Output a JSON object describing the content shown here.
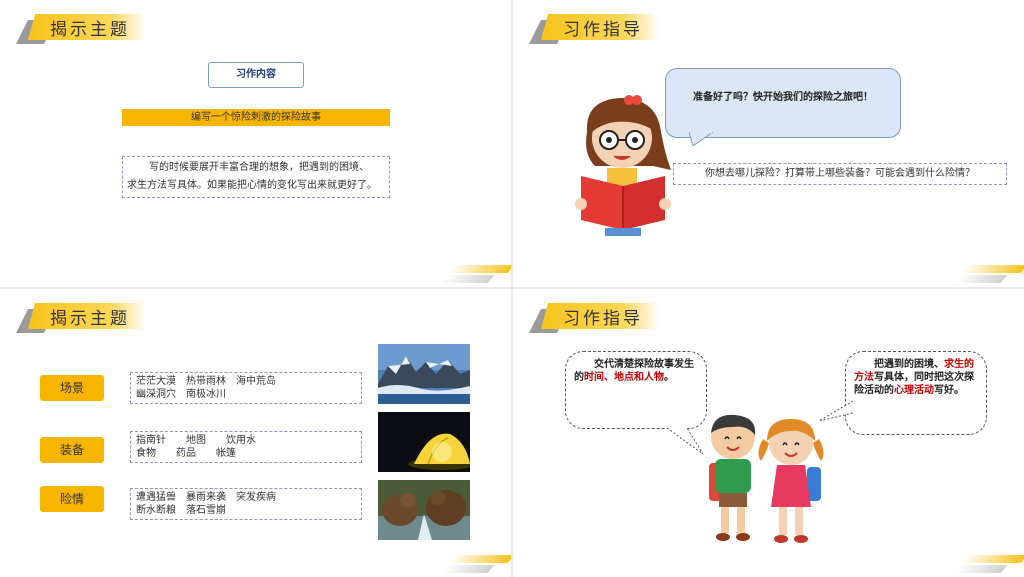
{
  "slide1": {
    "title": "揭示主题",
    "content_label": "习作内容",
    "topic": "编写一个惊险刺激的探险故事",
    "tip_line1": "写的时候要展开丰富合理的想象，把遇到的困境、",
    "tip_line2": "求生方法写具体。如果能把心情的变化写出来就更好了。"
  },
  "slide2": {
    "title": "习作指导",
    "bubble": "准备好了吗？快开始我们的探险之旅吧！",
    "question": "你想去哪儿探险？打算带上哪些装备？可能会遇到什么险情？"
  },
  "slide3": {
    "title": "揭示主题",
    "rows": [
      {
        "label": "场景",
        "line1": "茫茫大漠　热带雨林　海中荒岛",
        "line2": "幽深洞穴　南极冰川",
        "image": "iceberg-photo"
      },
      {
        "label": "装备",
        "line1": "指南针　　地图　　饮用水",
        "line2": "食物　　药品　　帐篷",
        "image": "tent-photo"
      },
      {
        "label": "险情",
        "line1": "遭遇猛兽　暴雨来袭　突发疾病",
        "line2": "断水断粮　落石雪崩",
        "image": "bears-photo"
      }
    ]
  },
  "slide4": {
    "title": "习作指导",
    "left_cloud": {
      "part1": "交代清楚探险故事发生的",
      "red1": "时间、地点和人物",
      "part2": "。"
    },
    "right_cloud": {
      "part1": "把遇到的困境、",
      "red1": "求生的方法",
      "part2": "写具体，同时把这次探险活动的",
      "red2": "心理活动",
      "part3": "写好。"
    }
  },
  "colors": {
    "accent": "#f7b500",
    "title_yellow": "#f7c21a",
    "border_blue": "#7a9ccc",
    "dash_purple": "#9a8fc8",
    "emphasis_red": "#c00000"
  }
}
